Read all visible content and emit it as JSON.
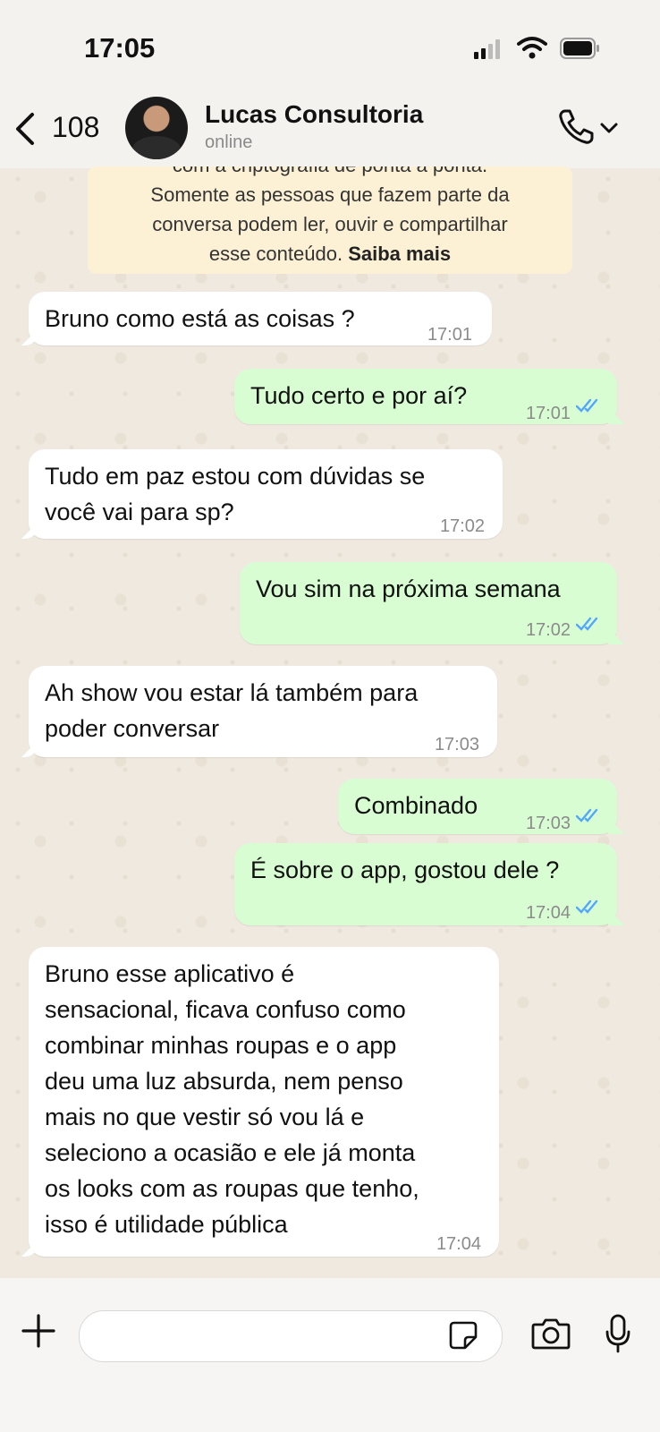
{
  "status_bar": {
    "time": "17:05"
  },
  "header": {
    "back_count": "108",
    "contact_name": "Lucas Consultoria",
    "contact_status": "online"
  },
  "encryption_notice": {
    "line1": "com a criptografia de ponta a ponta.",
    "line2": "Somente as pessoas que fazem parte da",
    "line3": "conversa podem ler, ouvir e compartilhar",
    "line4_prefix": "esse conteúdo. ",
    "link": "Saiba mais"
  },
  "messages": [
    {
      "direction": "in",
      "text": "Bruno como está as coisas ?",
      "time": "17:01"
    },
    {
      "direction": "out",
      "text": "Tudo certo e por aí?",
      "time": "17:01",
      "read": true
    },
    {
      "direction": "in",
      "text": "Tudo em paz estou com dúvidas se\nvocê vai para sp?",
      "time": "17:02"
    },
    {
      "direction": "out",
      "text": "Vou sim na próxima semana",
      "time": "17:02",
      "read": true
    },
    {
      "direction": "in",
      "text": "Ah show vou estar lá também para\npoder conversar",
      "time": "17:03"
    },
    {
      "direction": "out",
      "text": "Combinado",
      "time": "17:03",
      "read": true
    },
    {
      "direction": "out",
      "text": "É sobre o app, gostou dele ?",
      "time": "17:04",
      "read": true
    },
    {
      "direction": "in",
      "text": "Bruno esse aplicativo é\nsensacional, ficava confuso como\ncombinar minhas roupas e o app\ndeu uma luz absurda, nem penso\nmais no que vestir só vou lá e\nseleciono a ocasião e ele já monta\nos looks com as roupas que tenho,\nisso é utilidade pública",
      "time": "17:04"
    }
  ],
  "composer": {
    "placeholder": ""
  },
  "colors": {
    "incoming_bubble": "#ffffff",
    "outgoing_bubble": "#d9fdd3",
    "notice_bg": "#fcf1d5",
    "read_tick": "#53a6fd"
  },
  "icons": [
    "back-chevron-icon",
    "phone-icon",
    "chevron-down-icon",
    "plus-icon",
    "sticker-icon",
    "camera-icon",
    "microphone-icon",
    "double-check-icon"
  ]
}
